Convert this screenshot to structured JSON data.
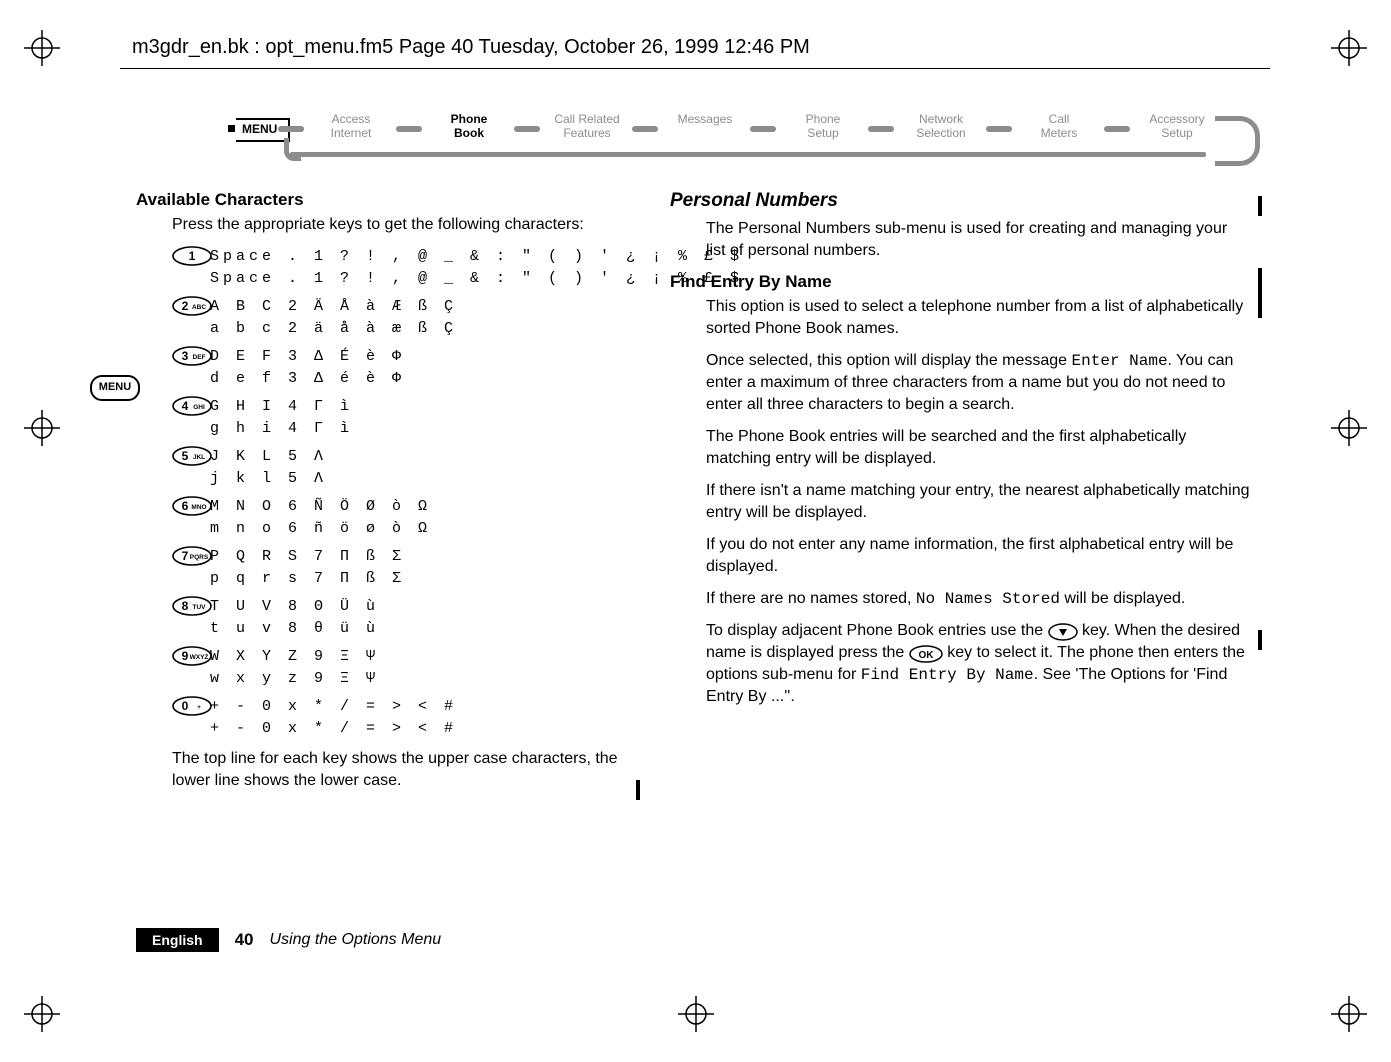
{
  "header": {
    "running_head": "m3gdr_en.bk : opt_menu.fm5  Page 40  Tuesday, October 26, 1999  12:46 PM"
  },
  "menu_diagram": {
    "menu_label": "MENU",
    "nodes": [
      {
        "label_top": "Access",
        "label_bottom": "Internet",
        "current": false
      },
      {
        "label_top": "Phone",
        "label_bottom": "Book",
        "current": true
      },
      {
        "label_top": "Call Related",
        "label_bottom": "Features",
        "current": false
      },
      {
        "label_top": "Messages",
        "label_bottom": "",
        "current": false
      },
      {
        "label_top": "Phone",
        "label_bottom": "Setup",
        "current": false
      },
      {
        "label_top": "Network",
        "label_bottom": "Selection",
        "current": false
      },
      {
        "label_top": "Call",
        "label_bottom": "Meters",
        "current": false
      },
      {
        "label_top": "Accessory",
        "label_bottom": "Setup",
        "current": false
      }
    ]
  },
  "side_menu_label": "MENU",
  "left": {
    "heading": "Available Characters",
    "intro": "Press the appropriate keys to get the following characters:",
    "rows": [
      {
        "key": "1",
        "upper": "Space . 1 ? ! , @ _ & : \" ( ) ' ¿ ¡ % £ $",
        "lower": "Space . 1 ? ! , @ _ & : \" ( ) ' ¿ ¡ % £ $"
      },
      {
        "key": "2ABC",
        "upper": "A B C 2 Ä Å à Æ ß Ç",
        "lower": "a b c 2 ä å à æ ß Ç"
      },
      {
        "key": "3DEF",
        "upper": "D E F 3 Δ É è Φ",
        "lower": "d e f 3 Δ é è Φ"
      },
      {
        "key": "4GHI",
        "upper": "G H I 4 Γ ì",
        "lower": "g h i 4 Γ ì"
      },
      {
        "key": "5JKL",
        "upper": "J K L 5 Λ",
        "lower": "j k l 5 Λ"
      },
      {
        "key": "6MNO",
        "upper": "M N O 6 Ñ Ö Ø ò Ω",
        "lower": "m n o 6 ñ ö ø ò Ω"
      },
      {
        "key": "7PQRS",
        "upper": "P Q R S 7 Π ß Σ",
        "lower": "p q r s 7 Π ß Σ"
      },
      {
        "key": "8TUV",
        "upper": "T U V 8 Θ Ü ù",
        "lower": "t u v 8 θ ü ù"
      },
      {
        "key": "9WXYZ",
        "upper": "W X Y Z 9 Ξ Ψ",
        "lower": "w x y z 9 Ξ Ψ"
      },
      {
        "key": "0+",
        "upper": "+ - 0 x * / = > < #",
        "lower": "+ - 0 x * / = > < #"
      }
    ],
    "footnote": "The top line for each key shows the upper case characters, the lower line shows the lower case."
  },
  "right": {
    "heading": "Personal Numbers",
    "p1": "The Personal Numbers sub-menu is used for creating and managing your list of personal numbers.",
    "sub1": "Find Entry By Name",
    "p2": "This option is used to select a telephone number from a list of alphabetically sorted Phone Book names.",
    "p3a": "Once selected, this option will display the message ",
    "p3_code1": "Enter Name",
    "p3b": ". You can enter a maximum of three characters from a name but you do not need to enter all three characters to begin a search.",
    "p4": "The Phone Book entries will be searched and the first alphabetically matching entry will be displayed.",
    "p5": "If there isn't a name matching your entry, the nearest alphabetically matching entry will be displayed.",
    "p6": "If you do not enter any name information, the first alphabetical entry will be displayed.",
    "p7a": "If there are no names stored, ",
    "p7_code": "No Names Stored",
    "p7b": " will be displayed.",
    "p8a": "To display adjacent Phone Book entries use the ",
    "p8b": " key. When the desired name is displayed press the ",
    "p8c": " key to select it. The phone then enters the options sub-menu for ",
    "p8_code": "Find Entry By Name",
    "p8d": ". See 'The Options for 'Find Entry By ...''."
  },
  "footer": {
    "lang": "English",
    "page": "40",
    "title": "Using the Options Menu"
  }
}
